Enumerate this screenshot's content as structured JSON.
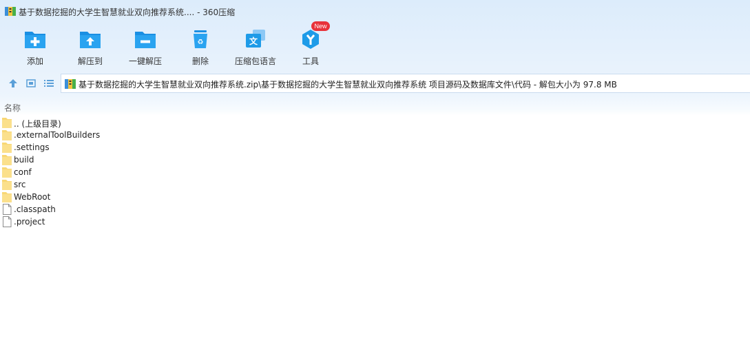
{
  "window": {
    "title": "基于数据挖掘的大学生智慧就业双向推荐系统.... - 360压缩"
  },
  "toolbar": {
    "items": [
      {
        "label": "添加",
        "icon": "add-folder-icon"
      },
      {
        "label": "解压到",
        "icon": "extract-to-icon"
      },
      {
        "label": "一键解压",
        "icon": "one-click-extract-icon"
      },
      {
        "label": "删除",
        "icon": "trash-icon"
      },
      {
        "label": "压缩包语言",
        "icon": "archive-language-icon"
      },
      {
        "label": "工具",
        "icon": "tools-icon"
      }
    ],
    "badge": "New"
  },
  "navbar": {
    "path": "基于数据挖掘的大学生智慧就业双向推荐系统.zip\\基于数据挖掘的大学生智慧就业双向推荐系统 项目源码及数据库文件\\代码 - 解包大小为 97.8 MB"
  },
  "list": {
    "header_name": "名称",
    "items": [
      {
        "name": ".. (上级目录)",
        "type": "folder"
      },
      {
        "name": ".externalToolBuilders",
        "type": "folder"
      },
      {
        "name": ".settings",
        "type": "folder"
      },
      {
        "name": "build",
        "type": "folder"
      },
      {
        "name": "conf",
        "type": "folder"
      },
      {
        "name": "src",
        "type": "folder"
      },
      {
        "name": "WebRoot",
        "type": "folder"
      },
      {
        "name": ".classpath",
        "type": "file"
      },
      {
        "name": ".project",
        "type": "file"
      }
    ]
  },
  "colors": {
    "accent": "#1e9be8",
    "badge": "#e8333a",
    "folder": "#f8d775"
  }
}
